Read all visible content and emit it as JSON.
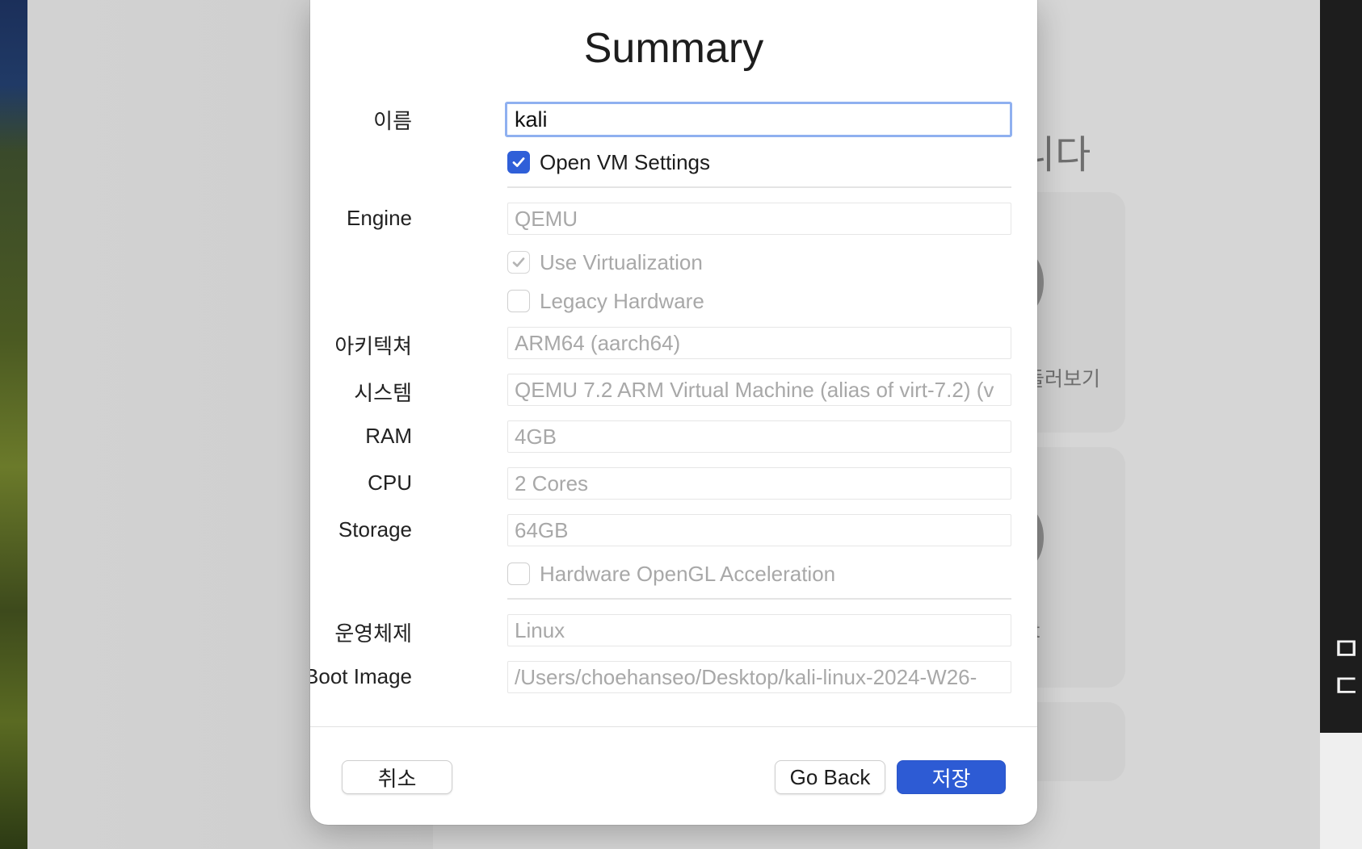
{
  "background": {
    "heading_fragment": "니다",
    "card1_text": "둘러보기",
    "card2_text": "t",
    "right_edge_glyphs": [
      "ㅁ",
      "ㄷ 후"
    ]
  },
  "dialog": {
    "title": "Summary",
    "name": {
      "label": "이름",
      "value": "kali"
    },
    "open_vm_settings": {
      "label": "Open VM Settings",
      "checked": true
    },
    "engine": {
      "label": "Engine",
      "value": "QEMU"
    },
    "use_virtualization": {
      "label": "Use Virtualization",
      "checked": true,
      "enabled": false
    },
    "legacy_hardware": {
      "label": "Legacy Hardware",
      "checked": false,
      "enabled": false
    },
    "architecture": {
      "label": "아키텍쳐",
      "value": "ARM64 (aarch64)"
    },
    "system": {
      "label": "시스템",
      "value": "QEMU 7.2 ARM Virtual Machine (alias of virt-7.2) (v"
    },
    "ram": {
      "label": "RAM",
      "value": "4GB"
    },
    "cpu": {
      "label": "CPU",
      "value": "2 Cores"
    },
    "storage": {
      "label": "Storage",
      "value": "64GB"
    },
    "hardware_opengl": {
      "label": "Hardware OpenGL Acceleration",
      "checked": false,
      "enabled": false
    },
    "os": {
      "label": "운영체제",
      "value": "Linux"
    },
    "boot_image": {
      "label": "Boot Image",
      "value": "/Users/choehanseo/Desktop/kali-linux-2024-W26-"
    },
    "buttons": {
      "cancel": "취소",
      "go_back": "Go Back",
      "save": "저장"
    }
  },
  "colors": {
    "accent": "#2d5bd4",
    "focus_ring": "#8fb0f0",
    "disabled_text": "#a8a8a8"
  }
}
